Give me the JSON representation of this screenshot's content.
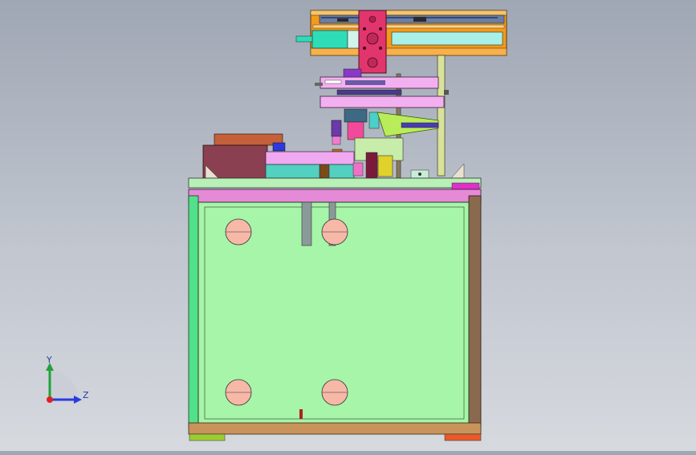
{
  "viewport": {
    "colors": {
      "background_top": "#9fa7b4",
      "background_bottom": "#d6d9de",
      "frame_face": "#a6f5a8",
      "frame_left_post": "#53e08a",
      "frame_right_post": "#8a6a4e",
      "top_rail": "#e58ad6",
      "base_rail": "#c9935c",
      "slide_module": "#f29a1c",
      "carriage": "#e2356d",
      "motor": "#2fdcb8",
      "holes": "#f7b8a8"
    }
  },
  "triad": {
    "y_label": "Y",
    "z_label": "Z",
    "icon": "coordinate-triad-icon"
  }
}
